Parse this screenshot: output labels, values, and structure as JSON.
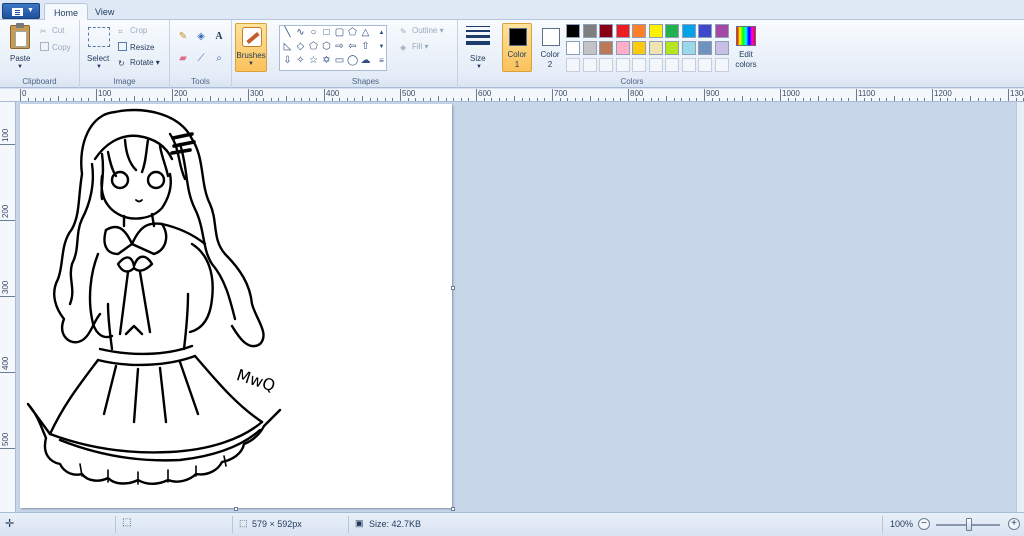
{
  "tabs": {
    "home": "Home",
    "view": "View"
  },
  "clipboard": {
    "paste": "Paste",
    "cut": "Cut",
    "copy": "Copy",
    "group": "Clipboard"
  },
  "image": {
    "select": "Select",
    "crop": "Crop",
    "resize": "Resize",
    "rotate": "Rotate",
    "group": "Image"
  },
  "tools": {
    "group": "Tools"
  },
  "brushes": {
    "label": "Brushes"
  },
  "shapes": {
    "outline": "Outline",
    "fill": "Fill",
    "group": "Shapes"
  },
  "size": {
    "label": "Size"
  },
  "colors": {
    "color1_label": "Color",
    "color1_num": "1",
    "color2_label": "Color",
    "color2_num": "2",
    "edit": "Edit",
    "edit2": "colors",
    "group": "Colors",
    "color1_value": "#000000",
    "color2_value": "#ffffff",
    "palette_row1": [
      "#000000",
      "#7f7f7f",
      "#880015",
      "#ed1c24",
      "#ff7f27",
      "#fff200",
      "#22b14c",
      "#00a2e8",
      "#3f48cc",
      "#a349a4"
    ],
    "palette_row2": [
      "#ffffff",
      "#c3c3c3",
      "#b97a57",
      "#ffaec9",
      "#ffc90e",
      "#efe4b0",
      "#b5e61d",
      "#99d9ea",
      "#7092be",
      "#c8bfe7"
    ]
  },
  "ruler": {
    "h": [
      "0",
      "100",
      "200",
      "300",
      "400",
      "500",
      "600",
      "700",
      "800",
      "900",
      "1000",
      "1100",
      "1200",
      "1300"
    ],
    "v": [
      "100",
      "200",
      "300",
      "400",
      "500"
    ]
  },
  "status": {
    "dimensions": "579 × 592px",
    "size": "Size: 42.7KB",
    "zoom": "100%"
  },
  "drawing": {
    "signature": "MwQ"
  }
}
